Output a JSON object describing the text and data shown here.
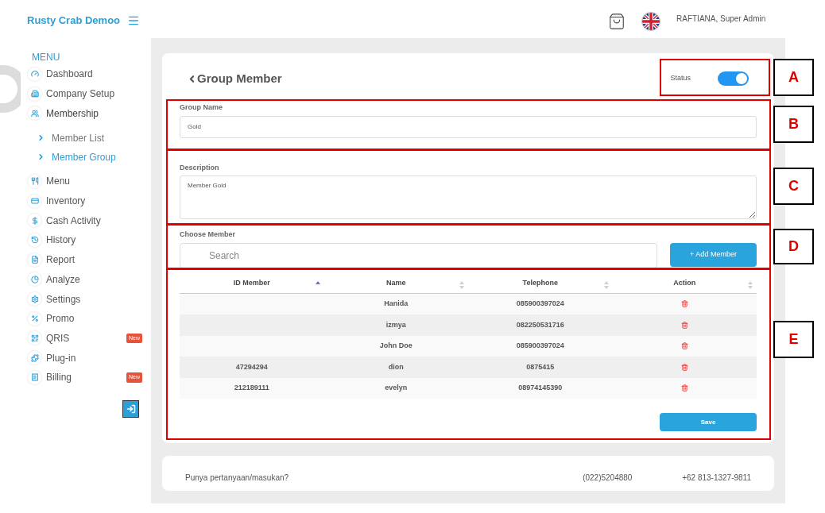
{
  "sidebar": {
    "brand": "Rusty Crab Demoo",
    "section": "MENU",
    "items": [
      {
        "label": "Dashboard",
        "expanded": false
      },
      {
        "label": "Company Setup",
        "expanded": false
      },
      {
        "label": "Membership",
        "expanded": true,
        "children": [
          {
            "label": "Member List",
            "selected": false
          },
          {
            "label": "Member Group",
            "selected": true
          }
        ]
      },
      {
        "label": "Menu",
        "expanded": false
      },
      {
        "label": "Inventory",
        "expanded": false
      },
      {
        "label": "Cash Activity",
        "expanded": false
      },
      {
        "label": "History",
        "expanded": false
      },
      {
        "label": "Report",
        "expanded": false
      },
      {
        "label": "Analyze",
        "expanded": false
      },
      {
        "label": "Settings",
        "expanded": false
      },
      {
        "label": "Promo",
        "expanded": false
      },
      {
        "label": "QRIS",
        "expanded": false,
        "badge": "New"
      },
      {
        "label": "Plug-in",
        "expanded": false
      },
      {
        "label": "Billing",
        "expanded": false,
        "badge": "New"
      }
    ]
  },
  "topbar": {
    "user": "RAFTIANA, Super Admin"
  },
  "form": {
    "title": "Group Member",
    "status": {
      "label": "Status",
      "on": true
    },
    "group_name": {
      "label": "Group Name",
      "value": "Gold"
    },
    "description": {
      "label": "Description",
      "value": "Member Gold"
    },
    "choose_member": {
      "label": "Choose Member",
      "placeholder": "Search",
      "button": "+ Add Member"
    },
    "table": {
      "columns": [
        {
          "label": "ID Member",
          "sorted": true
        },
        {
          "label": "Name",
          "sorted": false
        },
        {
          "label": "Telephone",
          "sorted": false
        },
        {
          "label": "Action",
          "sorted": false
        }
      ],
      "rows": [
        {
          "name": "Hanida",
          "telephone": "085900397024"
        },
        {
          "name": "izmya",
          "telephone": "082250531716"
        },
        {
          "name": "John Doe",
          "telephone": "085900397024"
        },
        {
          "id": "47294294",
          "name": "dion",
          "telephone": "0875415"
        },
        {
          "id": "212189111",
          "name": "evelyn",
          "telephone": "08974145390"
        }
      ]
    },
    "save": "Save"
  },
  "footer": {
    "question": "Punya pertanyaan/masukan?",
    "phone": "(022)5204880",
    "mobile": "+62 813-1327-9811"
  },
  "annotations": [
    "A",
    "B",
    "C",
    "D",
    "E"
  ]
}
